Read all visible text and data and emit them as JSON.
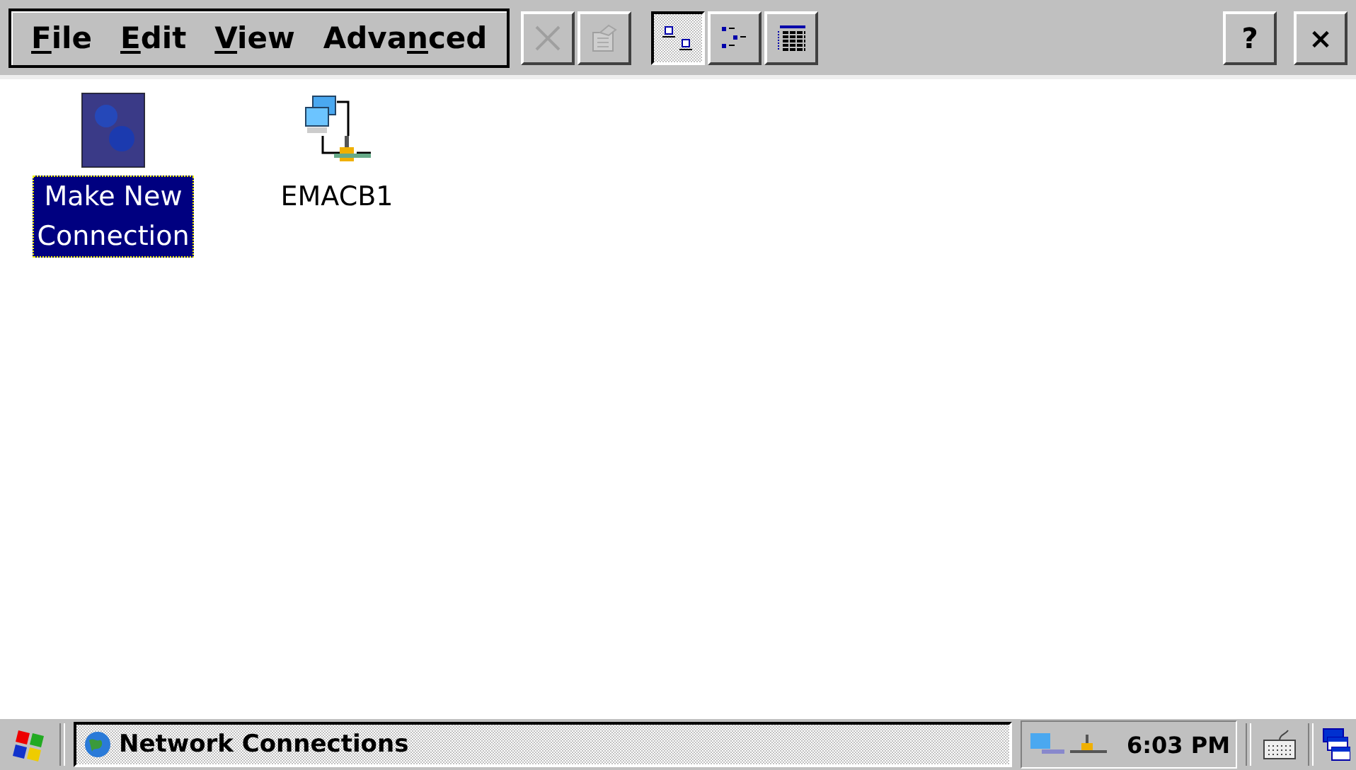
{
  "menu": [
    {
      "key": "F",
      "post": "ile"
    },
    {
      "key": "E",
      "post": "dit"
    },
    {
      "key": "V",
      "post": "iew"
    },
    {
      "pre": "Adva",
      "key": "n",
      "post": "ced"
    }
  ],
  "toolbar": [
    {
      "kind": "delete",
      "disabled": true,
      "selected": false
    },
    {
      "kind": "properties",
      "disabled": true,
      "selected": false
    },
    {
      "kind": "large-icons",
      "disabled": false,
      "selected": true
    },
    {
      "kind": "list",
      "disabled": false,
      "selected": false
    },
    {
      "kind": "details",
      "disabled": false,
      "selected": false
    }
  ],
  "help": "?",
  "close": "×",
  "items": [
    {
      "kind": "wizard",
      "lines": [
        "Make New",
        "Connection"
      ],
      "selected": true
    },
    {
      "kind": "adapter",
      "lines": [
        "EMACB1"
      ],
      "selected": false
    }
  ],
  "taskbar": {
    "window": "Network Connections",
    "clock": "6:03 PM"
  }
}
